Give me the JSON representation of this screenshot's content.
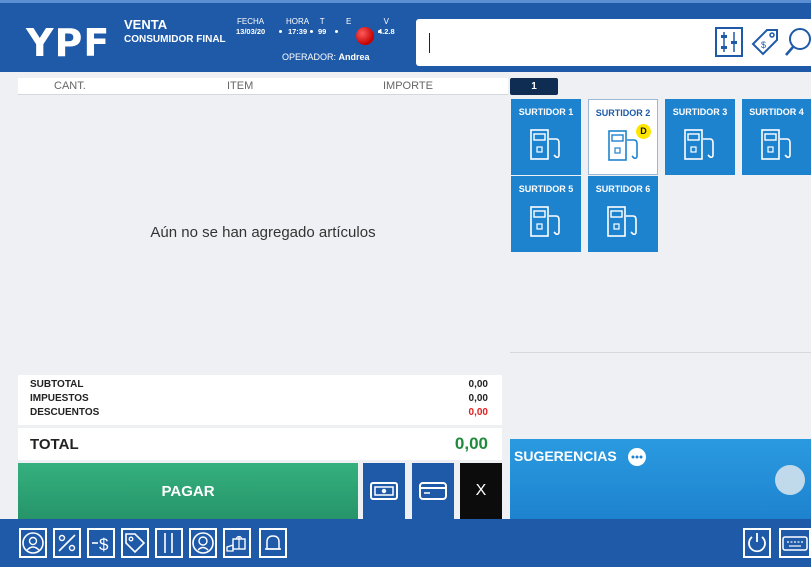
{
  "header": {
    "brand": "YPF",
    "mode_line1": "VENTA",
    "mode_line2": "CONSUMIDOR FINAL",
    "fecha_label": "FECHA",
    "fecha_value": "13/03/20",
    "hora_label": "HORA",
    "hora_value": "17:39",
    "t_label": "T",
    "t_value": "99",
    "e_label": "E",
    "v_label": "V",
    "v_value": "4.2.8",
    "operator_label": "OPERADOR:",
    "operator_value": "Andrea",
    "search_value": "",
    "icons": [
      "calculator-icon",
      "price-tag-icon",
      "search-icon"
    ]
  },
  "items": {
    "col_qty": "CANT.",
    "col_item": "ITEM",
    "col_amount": "IMPORTE",
    "empty_message": "Aún no se han agregado artículos"
  },
  "totals": {
    "subtotal_label": "SUBTOTAL",
    "subtotal_value": "0,00",
    "taxes_label": "IMPUESTOS",
    "taxes_value": "0,00",
    "discounts_label": "DESCUENTOS",
    "discounts_value": "0,00",
    "total_label": "TOTAL",
    "total_value": "0,00"
  },
  "actions": {
    "pay_label": "PAGAR",
    "cancel_label": "X"
  },
  "pumps": {
    "tab": "1",
    "list": [
      {
        "name": "SURTIDOR 1"
      },
      {
        "name": "SURTIDOR 2",
        "badge": "D"
      },
      {
        "name": "SURTIDOR 3"
      },
      {
        "name": "SURTIDOR 4"
      },
      {
        "name": "SURTIDOR 5"
      },
      {
        "name": "SURTIDOR 6"
      }
    ]
  },
  "suggestions": {
    "title": "SUGERENCIAS"
  },
  "colors": {
    "brand_blue": "#1e5aa8",
    "pump_blue": "#1e83cf",
    "pay_green": "#26956a",
    "total_green": "#1f8a3b",
    "discount_red": "#e02020",
    "status_red": "#c60000",
    "badge_yellow": "#ffe600"
  },
  "bottom_bar": {
    "icons": [
      "customer-icon",
      "percent-discount-icon",
      "price-change-icon",
      "tag-icon",
      "barcode-icon",
      "driver-icon",
      "gift-icon",
      "bell-icon",
      "power-icon",
      "keyboard-icon"
    ]
  }
}
